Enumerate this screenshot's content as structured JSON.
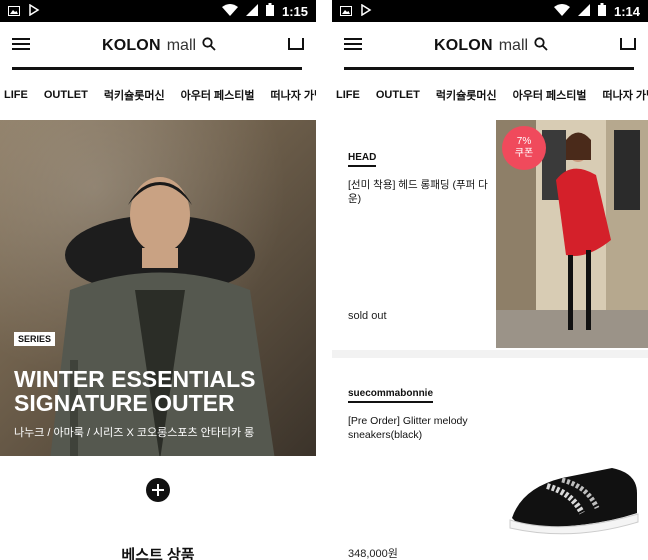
{
  "left": {
    "status": {
      "time": "1:15"
    },
    "logo": {
      "main": "KOLON",
      "sub": "mall"
    },
    "tabs": [
      "LIFE",
      "OUTLET",
      "럭키슐롯머신",
      "아우터 페스티벌",
      "떠나자 가볍:"
    ],
    "hero": {
      "badge": "SERIES",
      "title_line1": "WINTER ESSENTIALS",
      "title_line2": "SIGNATURE OUTER",
      "subtitle": "나누크 / 아마룩 / 시리즈 X 코오롱스포츠 안타티카 롱"
    },
    "section_title": "베스트 상품"
  },
  "right": {
    "status": {
      "time": "1:14"
    },
    "logo": {
      "main": "KOLON",
      "sub": "mall"
    },
    "tabs": [
      "LIFE",
      "OUTLET",
      "럭키슐롯머신",
      "아우터 페스티벌",
      "떠나자 가볍:"
    ],
    "products": [
      {
        "brand": "HEAD",
        "name": "[선미 착용] 헤드 롱패딩 (푸퍼 다운)",
        "status": "sold out",
        "coupon_pct": "7%",
        "coupon_label": "쿠폰"
      },
      {
        "brand": "suecommabonnie",
        "name": "[Pre Order] Glitter melody sneakers(black)",
        "price": "348,000원"
      }
    ]
  },
  "colors": {
    "accent_coupon": "#f04a5c",
    "statusbar": "#000000",
    "text": "#111111"
  }
}
